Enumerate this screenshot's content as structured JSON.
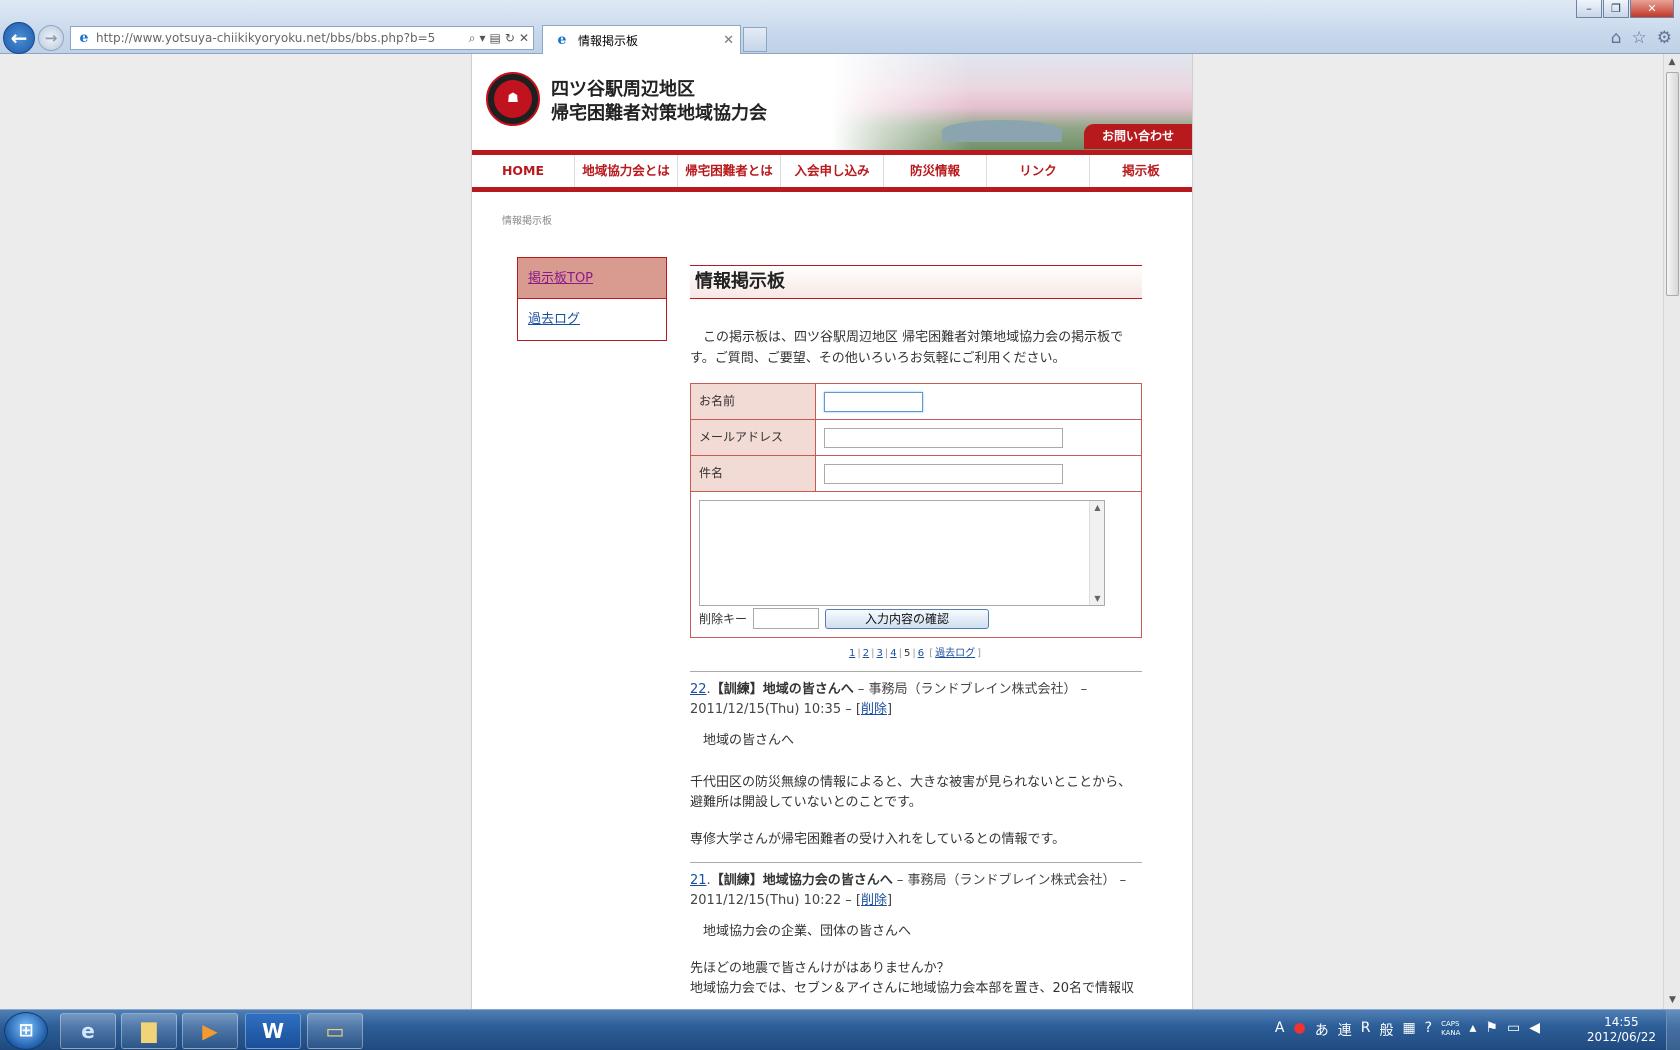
{
  "browser": {
    "window_title": "情報掲示板 - Windows Internet Explorer",
    "url": "http://www.yotsuya-chiikikyoryoku.net/bbs/bbs.php?b=5",
    "tab_title": "情報掲示板"
  },
  "site": {
    "title_line1": "四ツ谷駅周辺地区",
    "title_line2": "帰宅困難者対策地域協力会",
    "contact_label": "お問い合わせ",
    "nav": [
      "HOME",
      "地域協力会とは",
      "帰宅困難者とは",
      "入会申し込み",
      "防災情報",
      "リンク",
      "掲示板"
    ],
    "breadcrumb": "情報掲示板"
  },
  "sidebar": {
    "items": [
      {
        "label": "掲示板TOP"
      },
      {
        "label": "過去ログ"
      }
    ]
  },
  "main": {
    "title": "情報掲示板",
    "intro": "この掲示板は、四ツ谷駅周辺地区 帰宅困難者対策地域協力会の掲示板です。ご質問、ご要望、その他いろいろお気軽にご利用ください。",
    "form": {
      "name_label": "お名前",
      "email_label": "メールアドレス",
      "subject_label": "件名",
      "name_value": "",
      "email_value": "",
      "subject_value": "",
      "body_value": "",
      "delete_key_label": "削除キー",
      "submit_label": "入力内容の確認"
    },
    "pager": {
      "pages": [
        "1",
        "2",
        "3",
        "4",
        "5",
        "6"
      ],
      "current": "5",
      "past_log_label": "過去ログ"
    },
    "posts": [
      {
        "num": "22",
        "subject": "【訓練】地域の皆さんへ",
        "author": " – 事務局（ランドブレイン株式会社） –",
        "date": "2011/12/15(Thu) 10:35 –",
        "delete_label": "削除",
        "greeting": "地域の皆さんへ",
        "para1": "千代田区の防災無線の情報によると、大きな被害が見られないとことから、避難所は開設していないとのことです。",
        "para2": "専修大学さんが帰宅困難者の受け入れをしているとの情報です。"
      },
      {
        "num": "21",
        "subject": "【訓練】地域協力会の皆さんへ",
        "author": " – 事務局（ランドブレイン株式会社） –",
        "date": "2011/12/15(Thu) 10:22 –",
        "delete_label": "削除",
        "greeting": "地域協力会の企業、団体の皆さんへ",
        "para1": "先ほどの地震で皆さんけがはありませんか？",
        "para2": "地域協力会では、セブン＆アイさんに地域協力会本部を置き、20名で情報収"
      }
    ]
  },
  "taskbar": {
    "time": "14:55",
    "date": "2012/06/22",
    "tray_ime": "あ",
    "tray_ren": "連",
    "tray_r": "R",
    "tray_han": "般",
    "caps": "CAPS",
    "kana": "KANA"
  }
}
